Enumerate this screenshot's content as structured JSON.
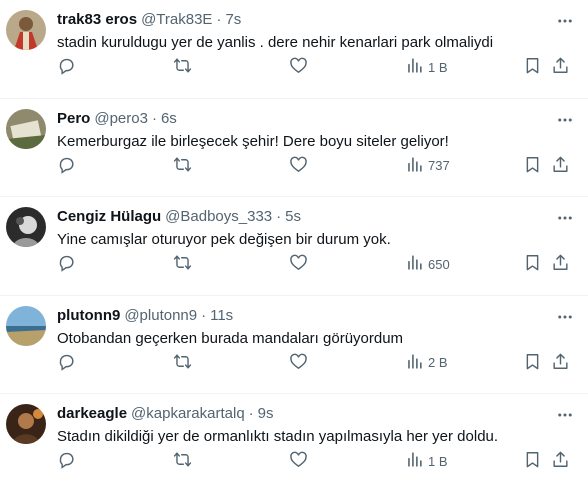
{
  "colors": {
    "text": "#0f1419",
    "secondary": "#536471",
    "divider": "#eff3f4"
  },
  "icons": {
    "reply": "reply-icon",
    "retweet": "retweet-icon",
    "like": "heart-icon",
    "views": "views-icon",
    "bookmark": "bookmark-icon",
    "share": "share-icon",
    "more": "more-icon"
  },
  "tweets": [
    {
      "name": "trak83 eros",
      "handle": "@Trak83E",
      "sep": "·",
      "time": "7s",
      "text": "stadin kuruldugu yer de yanlis . dere nehir kenarlari park olmaliydi",
      "views": "1 B"
    },
    {
      "name": "Pero",
      "handle": "@pero3",
      "sep": "·",
      "time": "6s",
      "text": "Kemerburgaz ile birleşecek şehir! Dere boyu siteler geliyor!",
      "views": "737"
    },
    {
      "name": "Cengiz Hülagu",
      "handle": "@Badboys_333",
      "sep": "·",
      "time": "5s",
      "text": "Yine camışlar oturuyor pek değişen bir durum yok.",
      "views": "650"
    },
    {
      "name": "plutonn9",
      "handle": "@plutonn9",
      "sep": "·",
      "time": "11s",
      "text": "Otobandan geçerken burada mandaları görüyordum",
      "views": "2 B"
    },
    {
      "name": "darkeagle",
      "handle": "@kapkarakartalq",
      "sep": "·",
      "time": "9s",
      "text": "Stadın dikildiği yer de ormanlıktı stadın yapılmasıyla her yer doldu.",
      "views": "1 B"
    }
  ]
}
